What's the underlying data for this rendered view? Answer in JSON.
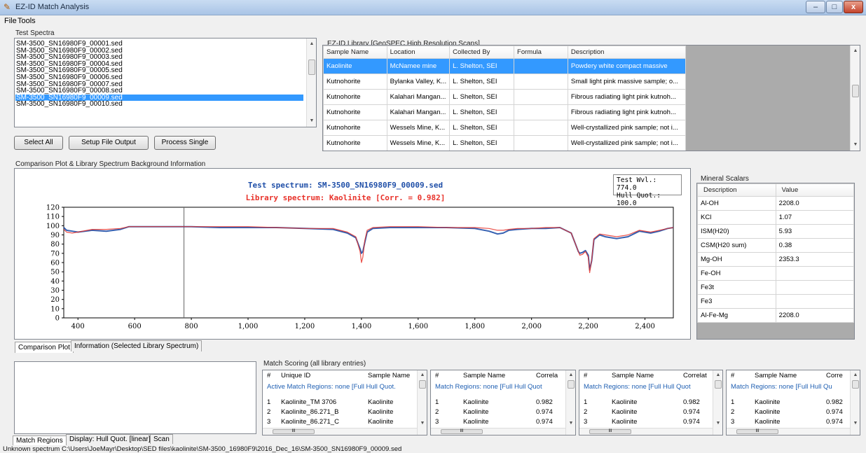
{
  "window": {
    "title": "EZ-ID Match Analysis",
    "min": "–",
    "max": "□",
    "close": "x"
  },
  "menu": {
    "file": "File",
    "tools": "Tools"
  },
  "test_spectra": {
    "label": "Test Spectra",
    "items": [
      "SM-3500_SN16980F9_00001.sed",
      "SM-3500_SN16980F9_00002.sed",
      "SM-3500_SN16980F9_00003.sed",
      "SM-3500_SN16980F9_00004.sed",
      "SM-3500_SN16980F9_00005.sed",
      "SM-3500_SN16980F9_00006.sed",
      "SM-3500_SN16980F9_00007.sed",
      "SM-3500_SN16980F9_00008.sed",
      "SM-3500_SN16980F9_00009.sed",
      "SM-3500_SN16980F9_00010.sed"
    ],
    "selected_index": 8
  },
  "buttons": {
    "select_all": "Select All",
    "setup_file_output": "Setup File Output",
    "process_single": "Process Single"
  },
  "library": {
    "label": "EZ-ID Library [GeoSPEC High Resolution Scans]",
    "columns": [
      "Sample Name",
      "Location",
      "Collected By",
      "Formula",
      "Description"
    ],
    "rows": [
      [
        "Kaolinite",
        "McNamee mine",
        "L. Shelton, SEI",
        "",
        "Powdery white compact massive"
      ],
      [
        "Kutnohorite",
        "Bylanka Valley, K...",
        "L. Shelton, SEI",
        "",
        "Small light pink massive sample; o..."
      ],
      [
        "Kutnohorite",
        "Kalahari Mangan...",
        "L. Shelton, SEI",
        "",
        "Fibrous radiating light pink kutnoh..."
      ],
      [
        "Kutnohorite",
        "Kalahari Mangan...",
        "L. Shelton, SEI",
        "",
        "Fibrous radiating light pink kutnoh..."
      ],
      [
        "Kutnohorite",
        "Wessels Mine, K...",
        "L. Shelton, SEI",
        "",
        "Well-crystallized pink sample; not i..."
      ],
      [
        "Kutnohorite",
        "Wessels Mine, K...",
        "L. Shelton, SEI",
        "",
        "Well-crystallized pink sample; not i..."
      ]
    ],
    "selected_index": 0
  },
  "plot_section": {
    "label": "Comparison Plot & Library Spectrum Background Information"
  },
  "readout": {
    "line1": "Test Wvl.: 774.0",
    "line2": "Hull Quot.: 100.0"
  },
  "colors": {
    "test": "#1f4fa8",
    "library": "#e8322a",
    "overlap": "#7a2a9a",
    "selection": "#3399ff",
    "subtext": "#1f5fb2"
  },
  "chart_data": {
    "type": "line",
    "title": "Test spectrum: SM-3500_SN16980F9_00009.sed",
    "subtitle": "Library spectrum: Kaolinite [Corr. = 0.982]",
    "xlabel": "",
    "ylabel": "",
    "xlim": [
      350,
      2500
    ],
    "ylim": [
      0,
      120
    ],
    "xticks": [
      "400",
      "600",
      "800",
      "1,000",
      "1,200",
      "1,400",
      "1,600",
      "1,800",
      "2,000",
      "2,200",
      "2,400"
    ],
    "yticks": [
      "0",
      "10",
      "20",
      "30",
      "40",
      "50",
      "60",
      "70",
      "80",
      "90",
      "100",
      "110",
      "120"
    ],
    "cursor_x": 774,
    "grid": false,
    "series": [
      {
        "name": "Test spectrum",
        "x": [
          350,
          360,
          380,
          400,
          450,
          500,
          550,
          580,
          600,
          700,
          800,
          900,
          1000,
          1100,
          1200,
          1300,
          1350,
          1380,
          1395,
          1400,
          1405,
          1412,
          1420,
          1440,
          1500,
          1600,
          1700,
          1800,
          1850,
          1880,
          1900,
          1920,
          1950,
          2000,
          2050,
          2100,
          2140,
          2155,
          2165,
          2170,
          2180,
          2190,
          2200,
          2205,
          2212,
          2220,
          2240,
          2260,
          2300,
          2340,
          2380,
          2420,
          2450,
          2480,
          2500
        ],
        "y": [
          98,
          95,
          94,
          93,
          95,
          94,
          96,
          99,
          99,
          99,
          99,
          98,
          98,
          98,
          97,
          96,
          92,
          87,
          75,
          70,
          72,
          82,
          93,
          97,
          98,
          98,
          98,
          97,
          94,
          91,
          92,
          95,
          96,
          97,
          97,
          98,
          92,
          80,
          72,
          70,
          71,
          73,
          68,
          52,
          62,
          85,
          90,
          88,
          86,
          88,
          94,
          92,
          94,
          97,
          98
        ]
      },
      {
        "name": "Library spectrum",
        "x": [
          350,
          360,
          380,
          400,
          450,
          500,
          550,
          580,
          600,
          700,
          800,
          900,
          1000,
          1100,
          1200,
          1300,
          1350,
          1380,
          1395,
          1400,
          1405,
          1412,
          1420,
          1440,
          1500,
          1600,
          1700,
          1800,
          1850,
          1880,
          1900,
          1920,
          1950,
          2000,
          2050,
          2100,
          2140,
          2155,
          2165,
          2170,
          2180,
          2190,
          2200,
          2205,
          2212,
          2220,
          2240,
          2260,
          2300,
          2340,
          2380,
          2420,
          2450,
          2480,
          2500
        ],
        "y": [
          96,
          93,
          92,
          93,
          96,
          96,
          97,
          99,
          99,
          99,
          99,
          99,
          99,
          98,
          97,
          97,
          93,
          88,
          72,
          60,
          66,
          84,
          95,
          98,
          99,
          99,
          98,
          98,
          97,
          95,
          95,
          96,
          97,
          97,
          98,
          98,
          92,
          80,
          72,
          68,
          69,
          72,
          66,
          49,
          63,
          86,
          91,
          90,
          88,
          90,
          95,
          93,
          95,
          97,
          98
        ]
      }
    ]
  },
  "mineral_scalars": {
    "label": "Mineral Scalars",
    "columns": [
      "Description",
      "Value"
    ],
    "rows": [
      [
        "Al-OH",
        "2208.0"
      ],
      [
        "KCl",
        "1.07"
      ],
      [
        "ISM(H20)",
        "5.93"
      ],
      [
        "CSM(H20 sum)",
        "0.38"
      ],
      [
        "Mg-OH",
        "2353.3"
      ],
      [
        "Fe-OH",
        ""
      ],
      [
        "Fe3t",
        ""
      ],
      [
        "Fe3",
        ""
      ],
      [
        "Al-Fe-Mg",
        "2208.0"
      ]
    ]
  },
  "tabs_top": [
    "Comparison Plot",
    "Information (Selected Library Spectrum)"
  ],
  "tabs_bottom": [
    "Match Regions",
    "Display: Hull Quot. [linear]",
    "Scan"
  ],
  "match_scoring": {
    "label": "Match Scoring (all library entries)",
    "panels": [
      {
        "cols": [
          "#",
          "Unique ID",
          "Sample Name"
        ],
        "sub": "Active Match Regions: none [Full Hull Quot.",
        "rows": [
          [
            "1",
            "Kaolinite_TM 3706",
            "Kaolinite"
          ],
          [
            "2",
            "Kaolinite_86.271_B",
            "Kaolinite"
          ],
          [
            "3",
            "Kaolinite_86.271_C",
            "Kaolinite"
          ]
        ]
      },
      {
        "cols": [
          "#",
          "Sample Name",
          "Correla"
        ],
        "sub": "Match Regions: none [Full Hull Quot",
        "rows": [
          [
            "1",
            "Kaolinite",
            "0.982"
          ],
          [
            "2",
            "Kaolinite",
            "0.974"
          ],
          [
            "3",
            "Kaolinite",
            "0.974"
          ]
        ]
      },
      {
        "cols": [
          "#",
          "Sample Name",
          "Correlat"
        ],
        "sub": "Match Regions: none [Full Hull Quot",
        "rows": [
          [
            "1",
            "Kaolinite",
            "0.982"
          ],
          [
            "2",
            "Kaolinite",
            "0.974"
          ],
          [
            "3",
            "Kaolinite",
            "0.974"
          ]
        ]
      },
      {
        "cols": [
          "#",
          "Sample Name",
          "Corre"
        ],
        "sub": "Match Regions: none [Full Hull Qu",
        "rows": [
          [
            "1",
            "Kaolinite",
            "0.982"
          ],
          [
            "2",
            "Kaolinite",
            "0.974"
          ],
          [
            "3",
            "Kaolinite",
            "0.974"
          ]
        ]
      }
    ]
  },
  "status": "Unknown spectrum C:\\Users\\JoeMayr\\Desktop\\SED files\\kaolinite\\SM-3500_16980F9\\2016_Dec_16\\SM-3500_SN16980F9_00009.sed"
}
